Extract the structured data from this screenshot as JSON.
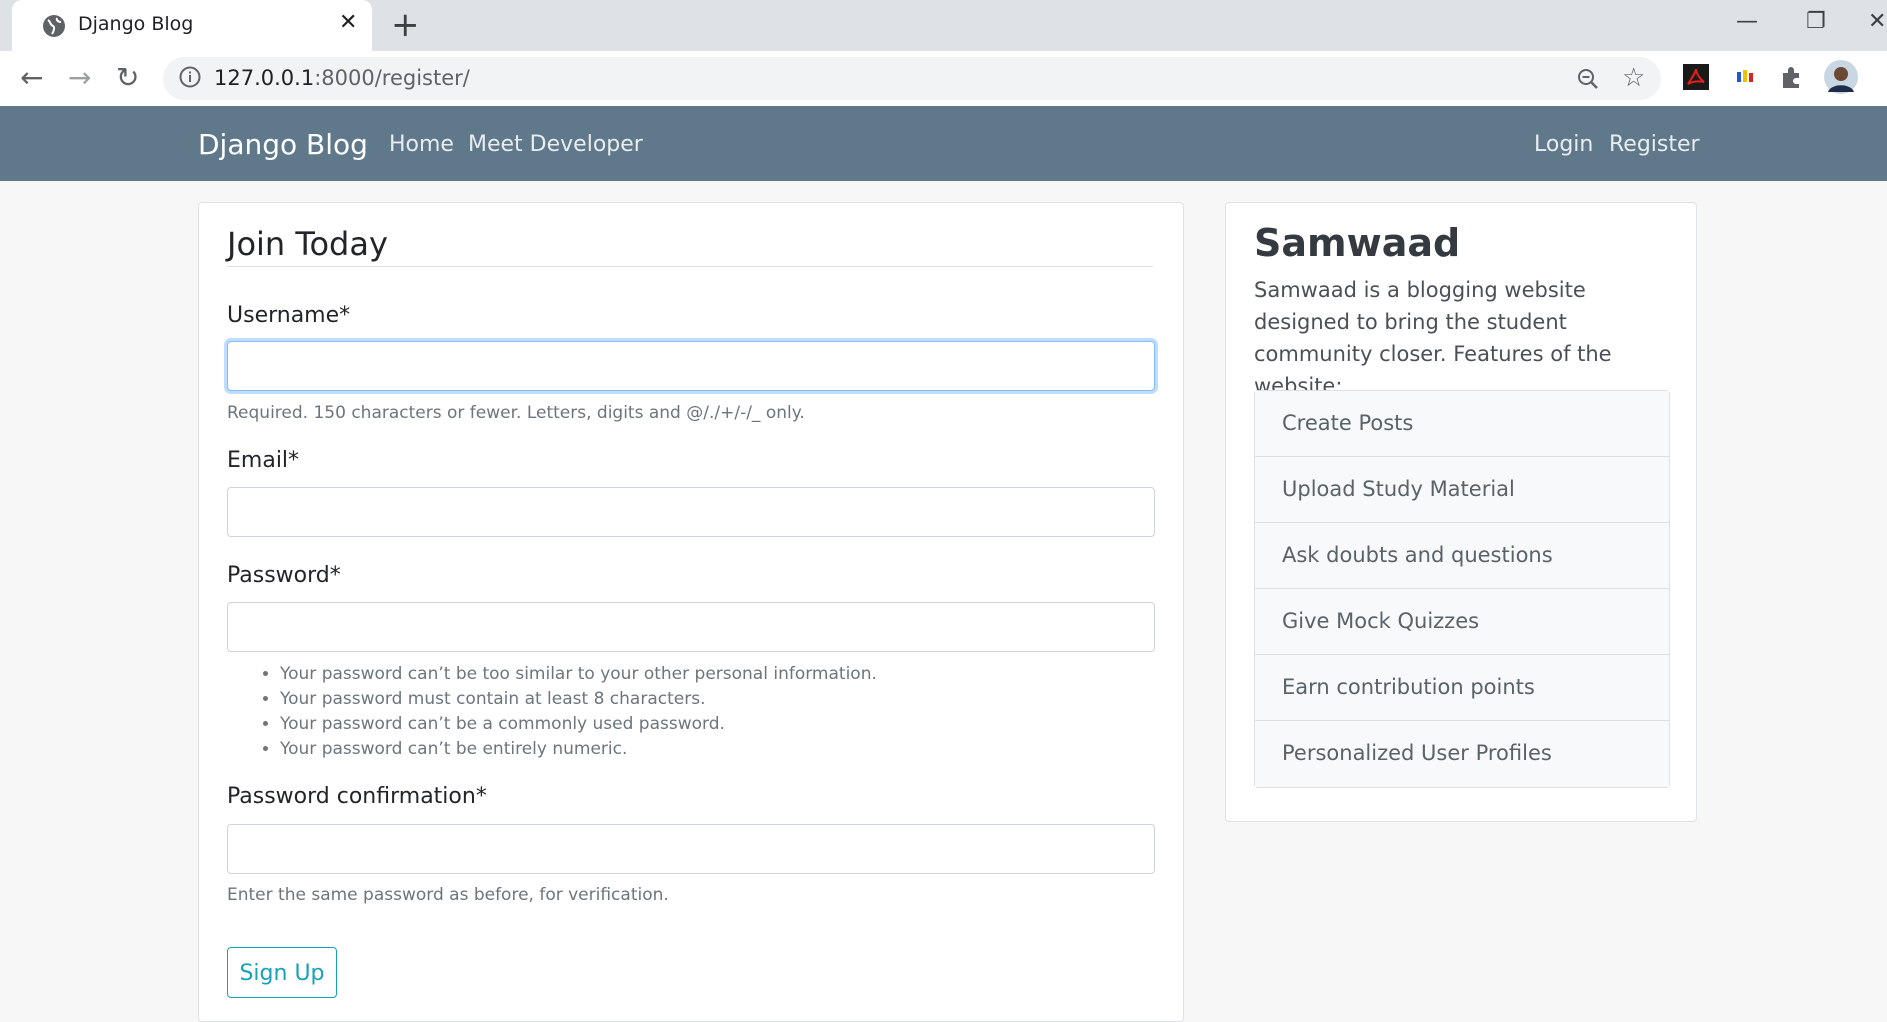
{
  "browser": {
    "tab_title": "Django Blog",
    "close_tab_glyph": "✕",
    "new_tab_glyph": "+",
    "url_host": "127.0.0.1",
    "url_rest": ":8000/register/",
    "minimize_glyph": "—",
    "restore_glyph": "❐",
    "close_window_glyph": "✕"
  },
  "navbar": {
    "brand": "Django Blog",
    "links": [
      "Home",
      "Meet Developer"
    ],
    "right_links": [
      "Login",
      "Register"
    ],
    "background_color": "#5f788a"
  },
  "form": {
    "legend": "Join Today",
    "username_label": "Username*",
    "username_help": "Required. 150 characters or fewer. Letters, digits and @/./+/-/_ only.",
    "email_label": "Email*",
    "password_label": "Password*",
    "password_help": [
      "Your password can’t be too similar to your other personal information.",
      "Your password must contain at least 8 characters.",
      "Your password can’t be a commonly used password.",
      "Your password can’t be entirely numeric."
    ],
    "password_confirm_label": "Password confirmation*",
    "password_confirm_help": "Enter the same password as before, for verification.",
    "submit_label": "Sign Up",
    "accent_color": "#17a2b8"
  },
  "sidebar": {
    "title": "Samwaad",
    "description": "Samwaad is a blogging website designed to bring the student community closer. Features of the website:",
    "features": [
      "Create Posts",
      "Upload Study Material",
      "Ask doubts and questions",
      "Give Mock Quizzes",
      "Earn contribution points",
      "Personalized User Profiles"
    ]
  }
}
